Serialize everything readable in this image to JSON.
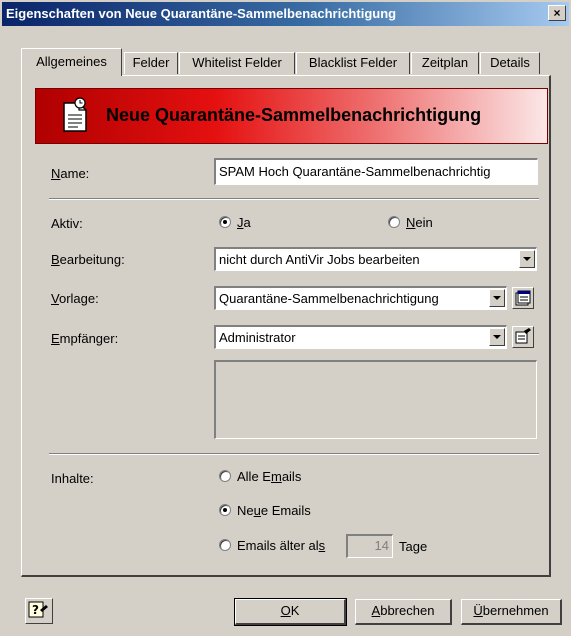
{
  "window": {
    "title": "Eigenschaften von Neue Quarantäne-Sammelbenachrichtigung",
    "close_label": "×"
  },
  "tabs": [
    {
      "label": "Allgemeines",
      "active": true
    },
    {
      "label": "Felder"
    },
    {
      "label": "Whitelist Felder"
    },
    {
      "label": "Blacklist Felder"
    },
    {
      "label": "Zeitplan"
    },
    {
      "label": "Details"
    }
  ],
  "banner": {
    "heading": "Neue Quarantäne-Sammelbenachrichtigung"
  },
  "form": {
    "name": {
      "label_u": "N",
      "label_rest": "ame:",
      "value": "SPAM Hoch Quarantäne-Sammelbenachrichtig"
    },
    "aktiv": {
      "label": "Aktiv:",
      "options": [
        {
          "u": "J",
          "rest": "a",
          "selected": true
        },
        {
          "u": "N",
          "rest": "ein",
          "selected": false
        }
      ]
    },
    "bearbeitung": {
      "label_u": "B",
      "label_rest": "earbeitung:",
      "value": "nicht durch AntiVir Jobs bearbeiten"
    },
    "vorlage": {
      "label_u": "V",
      "label_rest": "orlage:",
      "value": "Quarantäne-Sammelbenachrichtigung"
    },
    "empfaenger": {
      "label_u": "E",
      "label_rest": "mpfänger:",
      "value": "Administrator"
    },
    "inhalte": {
      "label": "Inhalte:",
      "options": [
        {
          "pre": "Alle E",
          "u": "m",
          "post": "ails",
          "selected": false
        },
        {
          "pre": "Ne",
          "u": "u",
          "post": "e Emails",
          "selected": true
        },
        {
          "pre": "Emails älter al",
          "u": "s",
          "post": "",
          "selected": false
        }
      ],
      "days_value": "14",
      "days_unit": "Tage"
    }
  },
  "buttons": {
    "ok": {
      "u": "O",
      "rest": "K"
    },
    "cancel": {
      "u": "A",
      "rest": "bbrechen"
    },
    "apply": {
      "u": "Ü",
      "rest": "bernehmen"
    }
  },
  "colors": {
    "titlebar_start": "#0a246a",
    "titlebar_end": "#a6caf0",
    "banner_red": "#e51010",
    "face": "#d4d0c8"
  },
  "icons": [
    "notification-document-icon",
    "properties-icon",
    "edit-recipient-icon",
    "help-icon",
    "dropdown-arrow-icon"
  ]
}
